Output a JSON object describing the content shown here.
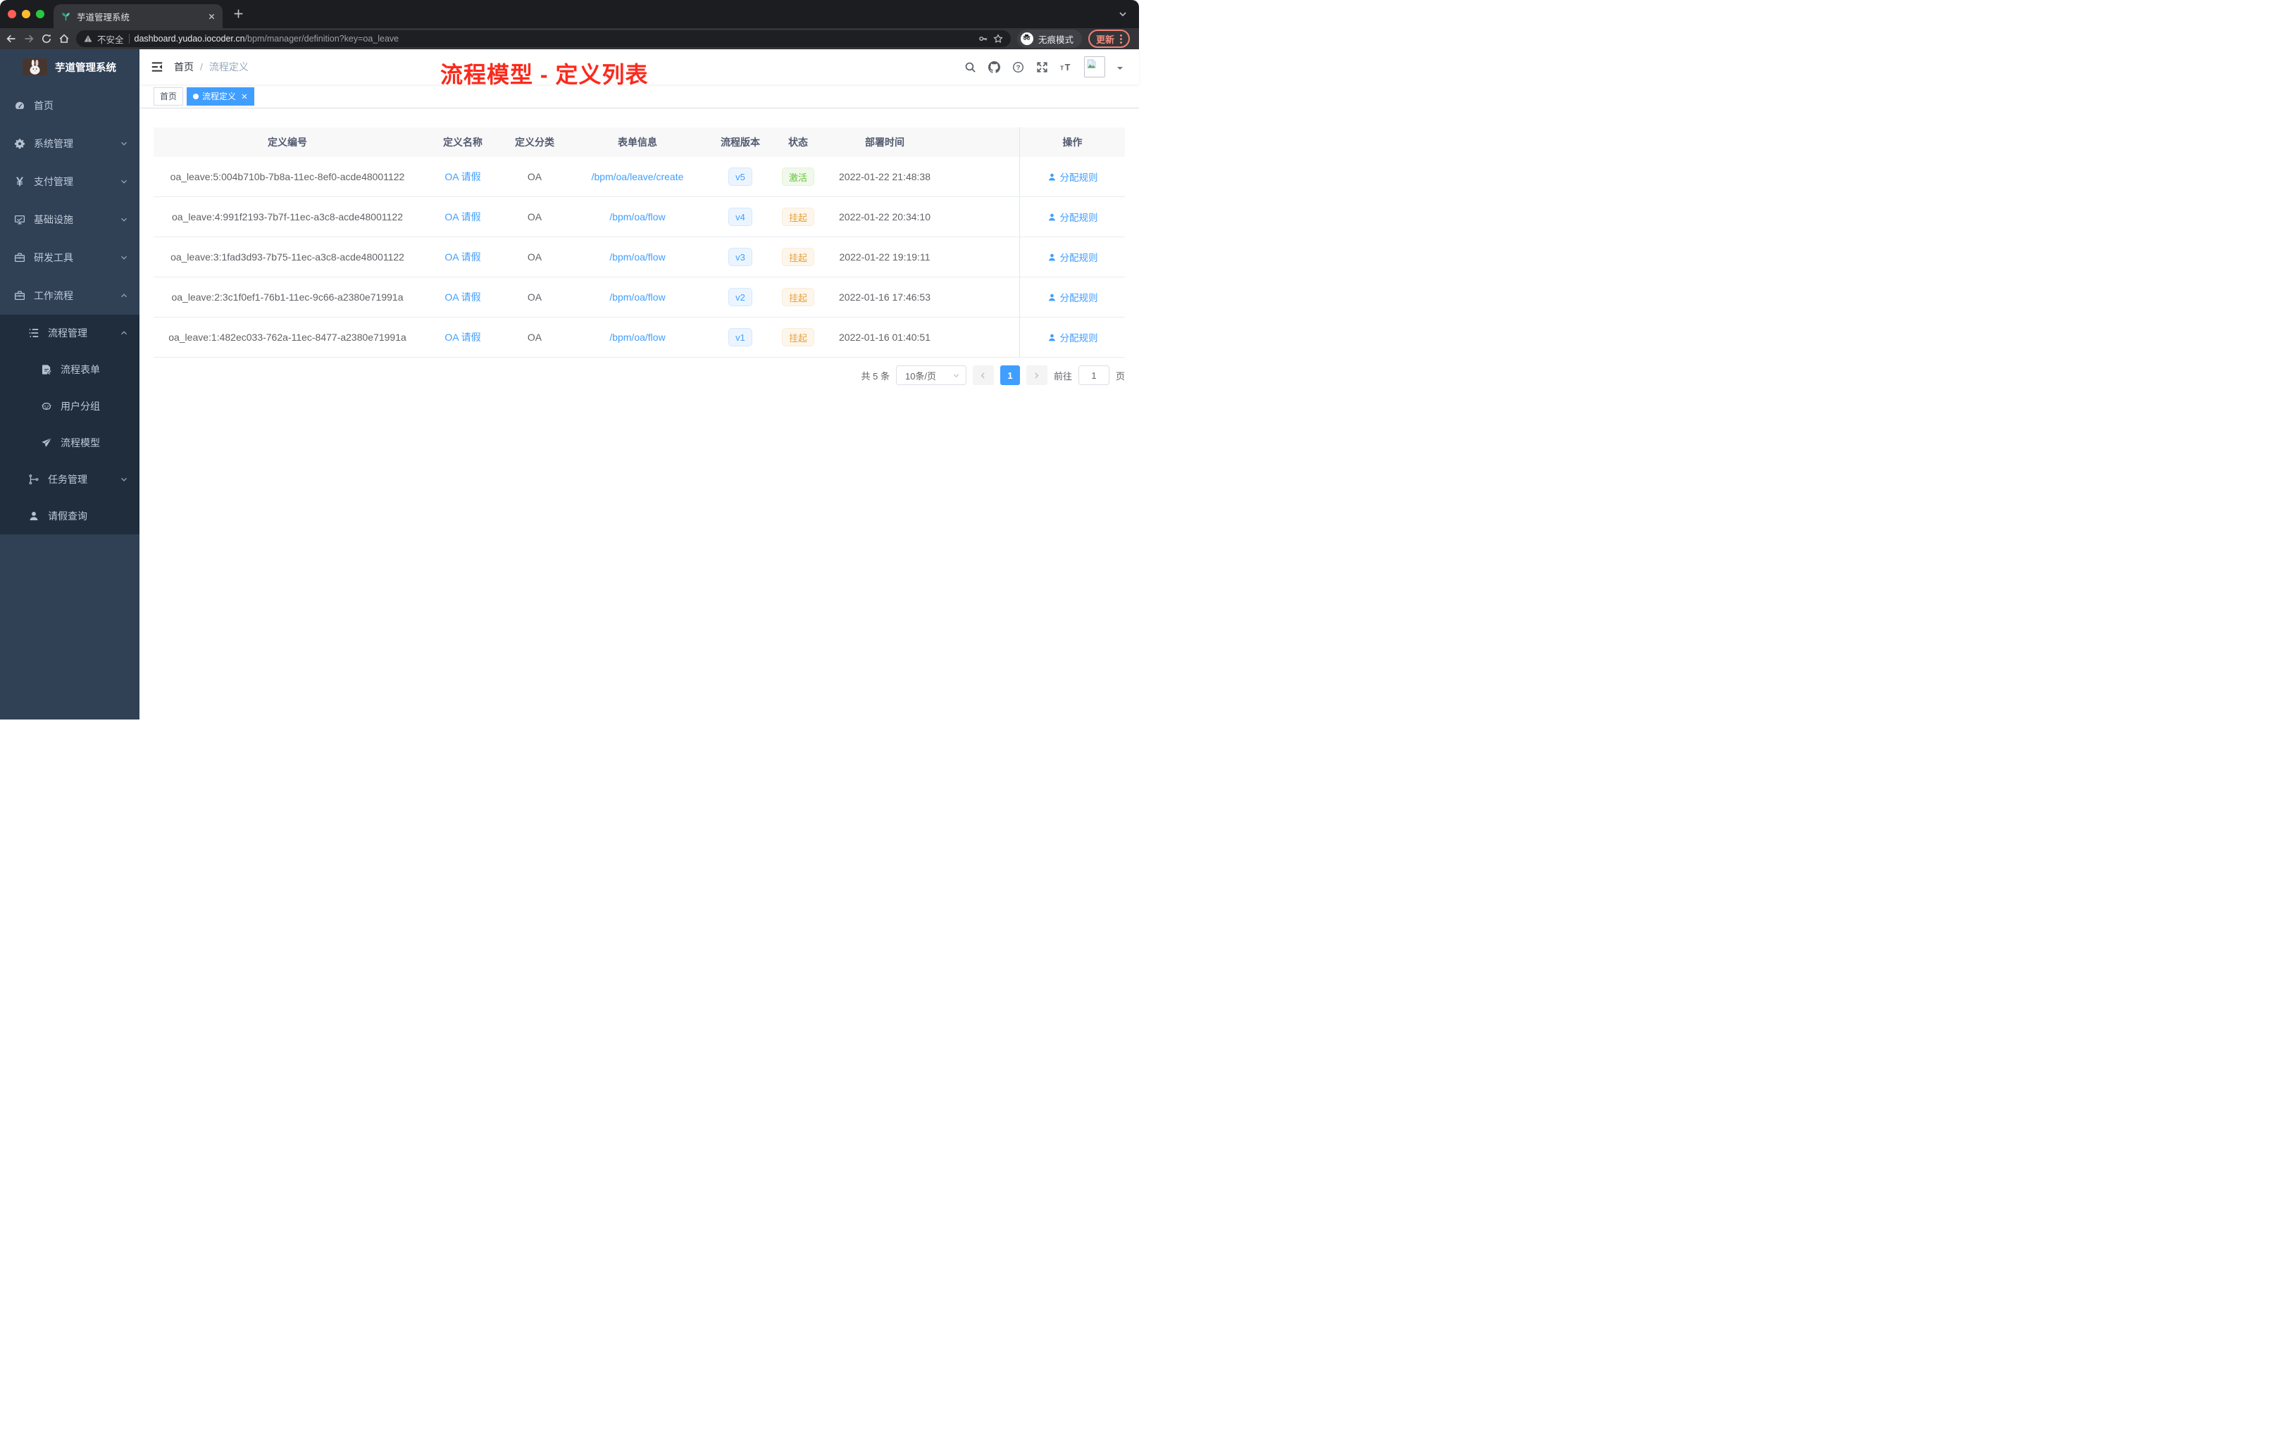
{
  "browser": {
    "tab_title": "芋道管理系统",
    "security_label": "不安全",
    "url_host": "dashboard.yudao.iocoder.cn",
    "url_path": "/bpm/manager/definition?key=oa_leave",
    "incognito_label": "无痕模式",
    "update_label": "更新"
  },
  "sidebar": {
    "logo_title": "芋道管理系统",
    "items": [
      {
        "key": "home",
        "label": "首页",
        "icon": "gauge",
        "level": 1
      },
      {
        "key": "system",
        "label": "系统管理",
        "icon": "gear",
        "level": 1,
        "chevron": "down"
      },
      {
        "key": "payment",
        "label": "支付管理",
        "icon": "yen",
        "level": 1,
        "chevron": "down"
      },
      {
        "key": "infra",
        "label": "基础设施",
        "icon": "monitor",
        "level": 1,
        "chevron": "down"
      },
      {
        "key": "devtools",
        "label": "研发工具",
        "icon": "toolbox",
        "level": 1,
        "chevron": "down"
      },
      {
        "key": "workflow",
        "label": "工作流程",
        "icon": "toolbox",
        "level": 1,
        "chevron": "up"
      }
    ],
    "submenu_items": [
      {
        "key": "process-mgmt",
        "label": "流程管理",
        "icon": "listtree",
        "level": 2,
        "chevron": "up"
      },
      {
        "key": "process-form",
        "label": "流程表单",
        "icon": "form",
        "level": 3
      },
      {
        "key": "user-group",
        "label": "用户分组",
        "icon": "robot",
        "level": 3
      },
      {
        "key": "process-model",
        "label": "流程模型",
        "icon": "send",
        "level": 3
      },
      {
        "key": "task-mgmt",
        "label": "任务管理",
        "icon": "tree",
        "level": 2,
        "chevron": "down"
      },
      {
        "key": "leave-query",
        "label": "请假查询",
        "icon": "user",
        "level": 2
      }
    ]
  },
  "header": {
    "breadcrumb_home": "首页",
    "breadcrumb_sep": "/",
    "breadcrumb_current": "流程定义",
    "annotation": "流程模型 - 定义列表"
  },
  "tags": {
    "home": "首页",
    "current": "流程定义"
  },
  "table": {
    "columns": [
      "定义编号",
      "定义名称",
      "定义分类",
      "表单信息",
      "流程版本",
      "状态",
      "部署时间",
      "操作"
    ],
    "rows": [
      {
        "id": "oa_leave:5:004b710b-7b8a-11ec-8ef0-acde48001122",
        "name": "OA 请假",
        "category": "OA",
        "form": "/bpm/oa/leave/create",
        "version": "v5",
        "status": "激活",
        "status_type": "success",
        "deploy_time": "2022-01-22 21:48:38",
        "action": "分配规则"
      },
      {
        "id": "oa_leave:4:991f2193-7b7f-11ec-a3c8-acde48001122",
        "name": "OA 请假",
        "category": "OA",
        "form": "/bpm/oa/flow",
        "version": "v4",
        "status": "挂起",
        "status_type": "warning",
        "deploy_time": "2022-01-22 20:34:10",
        "action": "分配规则"
      },
      {
        "id": "oa_leave:3:1fad3d93-7b75-11ec-a3c8-acde48001122",
        "name": "OA 请假",
        "category": "OA",
        "form": "/bpm/oa/flow",
        "version": "v3",
        "status": "挂起",
        "status_type": "warning",
        "deploy_time": "2022-01-22 19:19:11",
        "action": "分配规则"
      },
      {
        "id": "oa_leave:2:3c1f0ef1-76b1-11ec-9c66-a2380e71991a",
        "name": "OA 请假",
        "category": "OA",
        "form": "/bpm/oa/flow",
        "version": "v2",
        "status": "挂起",
        "status_type": "warning",
        "deploy_time": "2022-01-16 17:46:53",
        "action": "分配规则"
      },
      {
        "id": "oa_leave:1:482ec033-762a-11ec-8477-a2380e71991a",
        "name": "OA 请假",
        "category": "OA",
        "form": "/bpm/oa/flow",
        "version": "v1",
        "status": "挂起",
        "status_type": "warning",
        "deploy_time": "2022-01-16 01:40:51",
        "action": "分配规则"
      }
    ]
  },
  "pagination": {
    "total": "共 5 条",
    "page_size": "10条/页",
    "current_page": "1",
    "goto_label": "前往",
    "goto_value": "1",
    "page_unit": "页"
  },
  "colors": {
    "accent": "#409eff",
    "sidebar_bg": "#304156",
    "submenu_bg": "#1f2d3d",
    "status_active": "#67c23a",
    "status_suspended": "#e6a23c",
    "annotation_red": "#fb2a1c",
    "update_button": "#f08a7e"
  }
}
